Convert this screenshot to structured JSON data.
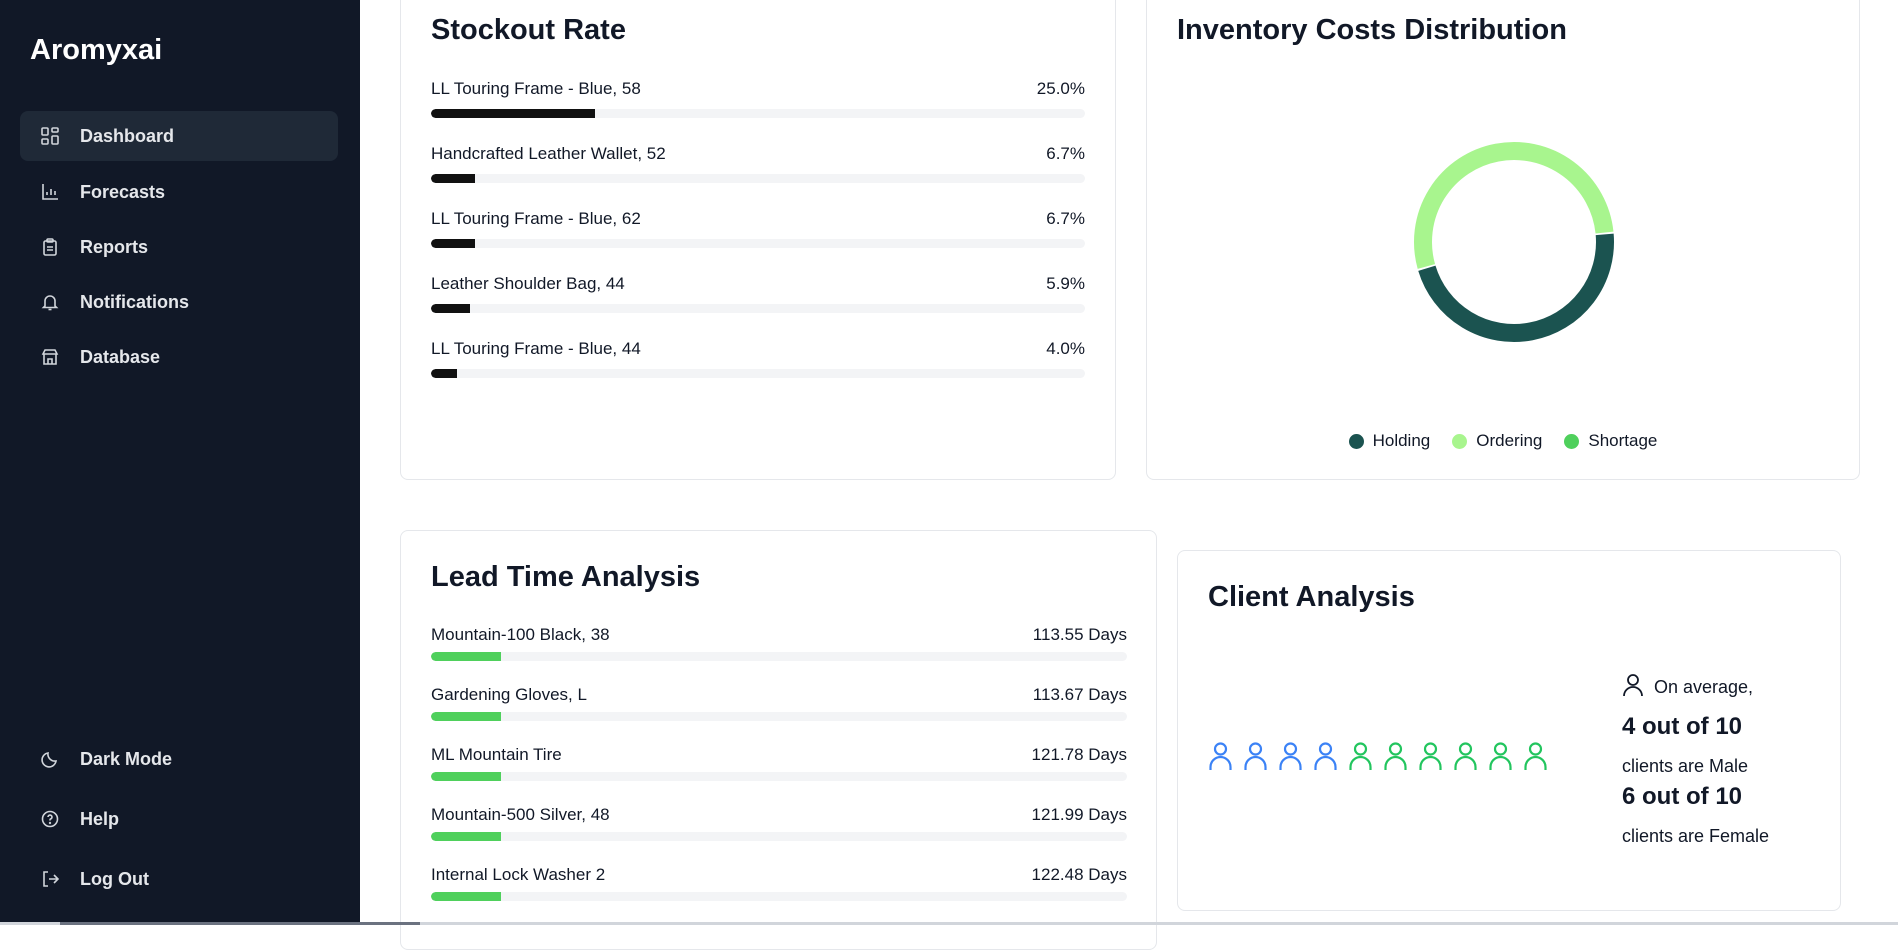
{
  "sidebar": {
    "brand": "Aromyxai",
    "items": [
      {
        "label": "Dashboard",
        "icon": "dashboard-icon",
        "active": true
      },
      {
        "label": "Forecasts",
        "icon": "chart-icon"
      },
      {
        "label": "Reports",
        "icon": "clipboard-icon"
      },
      {
        "label": "Notifications",
        "icon": "bell-icon"
      },
      {
        "label": "Database",
        "icon": "store-icon"
      }
    ],
    "bottom_items": [
      {
        "label": "Dark Mode",
        "icon": "moon-icon"
      },
      {
        "label": "Help",
        "icon": "help-circle-icon"
      },
      {
        "label": "Log Out",
        "icon": "logout-icon"
      }
    ]
  },
  "stockout": {
    "title": "Stockout Rate",
    "bar_color": "#111111",
    "rows": [
      {
        "label": "LL Touring Frame - Blue, 58",
        "value": "25.0%",
        "fraction": 0.25
      },
      {
        "label": "Handcrafted Leather Wallet, 52",
        "value": "6.7%",
        "fraction": 0.067
      },
      {
        "label": "LL Touring Frame - Blue, 62",
        "value": "6.7%",
        "fraction": 0.067
      },
      {
        "label": "Leather Shoulder Bag, 44",
        "value": "5.9%",
        "fraction": 0.059
      },
      {
        "label": "LL Touring Frame - Blue, 44",
        "value": "4.0%",
        "fraction": 0.04
      }
    ]
  },
  "inventory_costs": {
    "title": "Inventory Costs Distribution",
    "legend": [
      {
        "label": "Holding",
        "color": "#1b5350"
      },
      {
        "label": "Ordering",
        "color": "#a8f58e"
      },
      {
        "label": "Shortage",
        "color": "#4fd05c"
      }
    ]
  },
  "chart_data": {
    "type": "pie",
    "title": "Inventory Costs Distribution",
    "categories": [
      "Holding",
      "Ordering",
      "Shortage"
    ],
    "values": [
      47,
      53,
      0
    ],
    "colors": [
      "#1b5350",
      "#a8f58e",
      "#4fd05c"
    ],
    "legend_position": "bottom"
  },
  "lead_time": {
    "title": "Lead Time Analysis",
    "bar_color": "#4fd05c",
    "rows": [
      {
        "label": "Mountain-100 Black, 38",
        "value": "113.55 Days",
        "fraction": 0.1
      },
      {
        "label": "Gardening Gloves, L",
        "value": "113.67 Days",
        "fraction": 0.1
      },
      {
        "label": "ML Mountain Tire",
        "value": "121.78 Days",
        "fraction": 0.1
      },
      {
        "label": "Mountain-500 Silver, 48",
        "value": "121.99 Days",
        "fraction": 0.1
      },
      {
        "label": "Internal Lock Washer 2",
        "value": "122.48 Days",
        "fraction": 0.1
      }
    ]
  },
  "client": {
    "title": "Client Analysis",
    "intro": "On average,",
    "male_count": "4 out of 10",
    "male_text": "clients are Male",
    "female_count": "6 out of 10",
    "female_text": "clients are Female",
    "male_color": "#3b82f6",
    "female_color": "#22c55e",
    "male_icons": 4,
    "female_icons": 6
  }
}
